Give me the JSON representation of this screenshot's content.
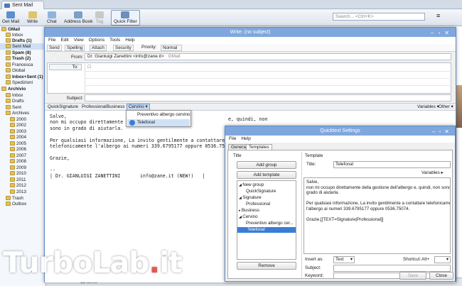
{
  "tab": {
    "label": "Sent Mail"
  },
  "toolbar": {
    "get_mail": "Get Mail",
    "write": "Write",
    "chat": "Chat",
    "address_book": "Address Book",
    "tag": "Tag",
    "quick_filter": "Quick Filter",
    "search_placeholder": "Search... <Ctrl+K>"
  },
  "sidebar": {
    "items": [
      {
        "label": "GMail",
        "bold": true
      },
      {
        "label": "Inbox"
      },
      {
        "label": "Drafts (1)",
        "bold": true
      },
      {
        "label": "Sent Mail",
        "selected": true
      },
      {
        "label": "Spam (8)",
        "bold": true
      },
      {
        "label": "Trash (2)",
        "bold": true
      },
      {
        "label": "Francesca"
      },
      {
        "label": "Global"
      },
      {
        "label": "Inbox+Sent (1)",
        "bold": true
      },
      {
        "label": "Spedizioni"
      },
      {
        "label": "Archivio",
        "bold": true
      },
      {
        "label": "Inbox"
      },
      {
        "label": "Drafts"
      },
      {
        "label": "Sent"
      },
      {
        "label": "Archives"
      },
      {
        "label": "2000"
      },
      {
        "label": "2002"
      },
      {
        "label": "2003"
      },
      {
        "label": "2004"
      },
      {
        "label": "2005"
      },
      {
        "label": "2006"
      },
      {
        "label": "2007"
      },
      {
        "label": "2008"
      },
      {
        "label": "2009"
      },
      {
        "label": "2010"
      },
      {
        "label": "2011"
      },
      {
        "label": "2012"
      },
      {
        "label": "2013"
      },
      {
        "label": "Trash"
      },
      {
        "label": "Outbox"
      }
    ]
  },
  "status": {
    "items": "13 items"
  },
  "compose": {
    "title": "Write: (no subject)",
    "menu": [
      "File",
      "Edit",
      "View",
      "Options",
      "Tools",
      "Help"
    ],
    "toolbar": [
      "Send",
      "Spelling",
      "Attach",
      "Security",
      "Priority:",
      "Normal"
    ],
    "from_label": "From:",
    "from_value": "Dr. Gianluigi Zanettini <info@zane.it>",
    "from_account": "GMail",
    "to_label": "To:",
    "subject_label": "Subject:",
    "qt_bar": [
      "QuickSignature",
      "Professional",
      "Business",
      "Cervino"
    ],
    "variables": "Variables",
    "other": "Other",
    "popup_items": [
      "Preventivo albergo cervino",
      "Telefona!"
    ],
    "body_lines": [
      "Salve,",
      "non mi occupo direttamente d",
      "sono in grado di aiutarla.",
      "",
      "Per qualsiasi informazione, La invito gentilmente a contattare",
      "telefonicamente l'albergo ai numeri 339.6795177 oppure 0536.75074",
      "",
      "Grazie,",
      "",
      "--",
      "| Dr. GIANLUIGI ZANETTINI       info@zane.it (NEW!)   |"
    ],
    "body_tail": "e, quindi, non"
  },
  "quicktext": {
    "title": "Quicktext Settings",
    "menu": [
      "File",
      "Help"
    ],
    "tabs": [
      "General",
      "Templates"
    ],
    "title_section": "Title",
    "add_group": "Add group",
    "add_template": "Add template",
    "remove": "Remove",
    "tree": [
      {
        "label": "New group",
        "level": 0,
        "expanded": true
      },
      {
        "label": "QuickSignature",
        "level": 1
      },
      {
        "label": "Signature",
        "level": 0,
        "expanded": true
      },
      {
        "label": "Professional",
        "level": 1
      },
      {
        "label": "Business",
        "level": 0,
        "expanded": false
      },
      {
        "label": "Cervino",
        "level": 0,
        "expanded": true
      },
      {
        "label": "Preventivo albergo cer...",
        "level": 1
      },
      {
        "label": "Telefona!",
        "level": 1,
        "selected": true
      }
    ],
    "template_section": "Template",
    "title_label": "Title:",
    "title_value": "Telefona!",
    "variables": "Variables",
    "template_text": "Salve,\nnon mi occupo direttamente della gestione dell'albergo e, quindi, non sono in\ngrado di aiutarla.\n\nPer qualsiasi informazione, La invito gentilmente a contattare telefonicamente\nl'albergo ai numeri 339.6795177 oppure 0536.75074.\n\nGrazie,[[TEXT=Signature|Professional]]",
    "insert_as_label": "Insert as:",
    "insert_as_value": "Text",
    "shortcut_label": "Shortcut:",
    "shortcut_value": "Alt+",
    "subject_label": "Subject:",
    "keyword_label": "Keyword:",
    "save": "Save",
    "close": "Close"
  },
  "watermark": {
    "text": "TurboLab",
    "dot": ".",
    "tld": "it"
  },
  "colors": {
    "titlebar": "#7fa7dd",
    "selection": "#3a7dd6",
    "accent": "#e0463c"
  }
}
